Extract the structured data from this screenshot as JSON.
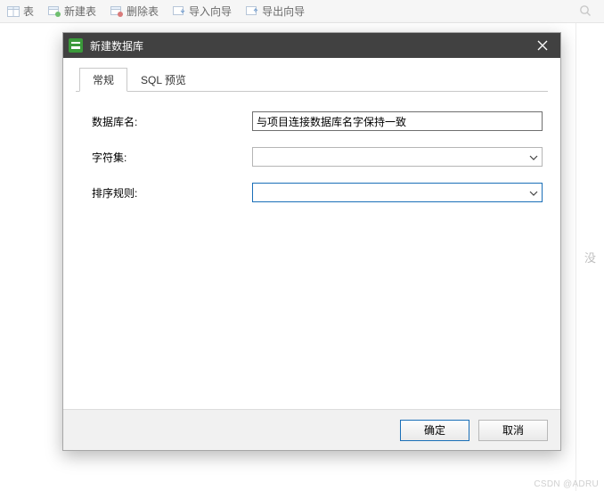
{
  "toolbar": {
    "items": [
      {
        "label": "表"
      },
      {
        "label": "新建表"
      },
      {
        "label": "删除表"
      },
      {
        "label": "导入向导"
      },
      {
        "label": "导出向导"
      }
    ]
  },
  "backdrop_hint": "没",
  "dialog": {
    "title": "新建数据库",
    "tabs": [
      {
        "label": "常规",
        "active": true
      },
      {
        "label": "SQL 预览",
        "active": false
      }
    ],
    "fields": {
      "db_name": {
        "label": "数据库名:",
        "value": "与项目连接数据库名字保持一致"
      },
      "charset": {
        "label": "字符集:",
        "value": ""
      },
      "collation": {
        "label": "排序规则:",
        "value": ""
      }
    },
    "buttons": {
      "ok": "确定",
      "cancel": "取消"
    }
  },
  "watermark": "CSDN @ADRU"
}
